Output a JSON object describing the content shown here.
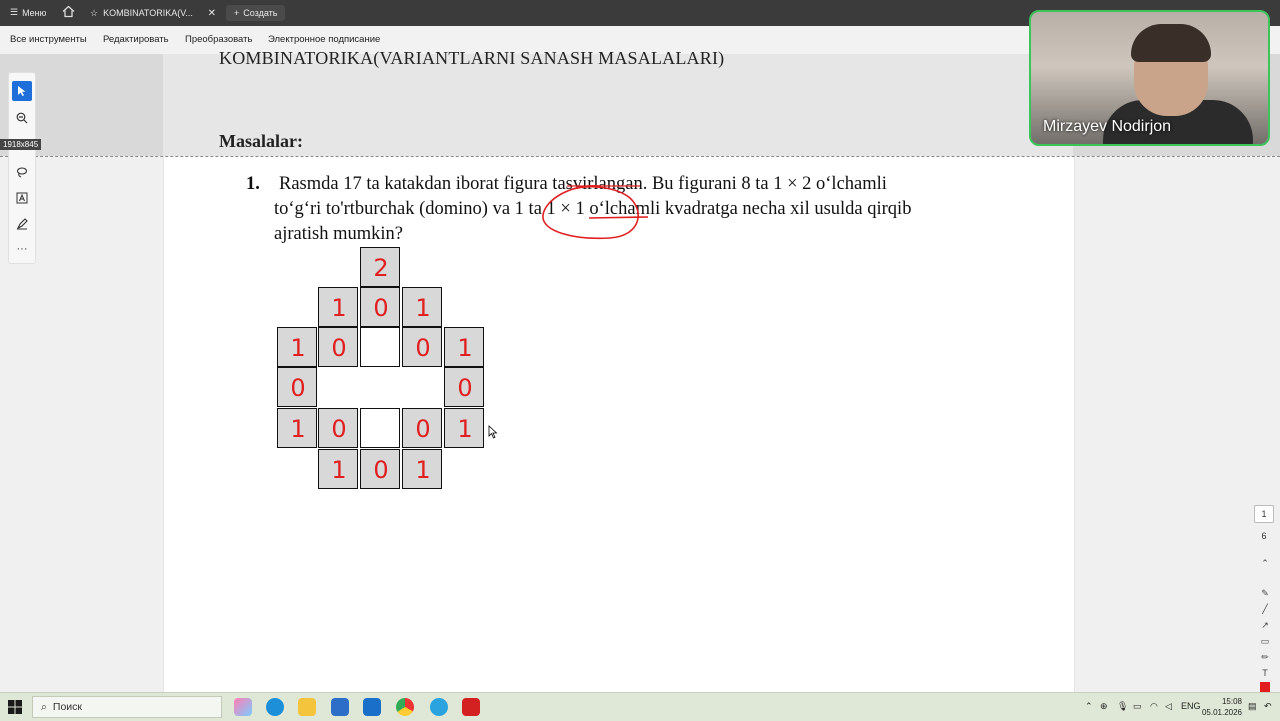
{
  "tabbar": {
    "menu_label": "Меню",
    "tab_title": "KOMBINATORIKA(V...",
    "new_tab_label": "Создать"
  },
  "menubar": {
    "items": [
      "Все инструменты",
      "Редактировать",
      "Преобразовать",
      "Электронное подписание"
    ]
  },
  "document": {
    "heading": "KOMBINATORIKA(VARIANTLARNI SANASH MASALALARI)",
    "section": "Masalalar:",
    "problem": {
      "number": "1.",
      "line1": "Rasmda 17 ta katakdan iborat figura tasvirlangan. Bu figurani 8 ta 1 × 2 o‘lchamli",
      "line2": "to‘g‘ri to'rtburchak (domino) va 1 ta 1 × 1 o‘lchamli kvadratga necha xil usulda qirqib",
      "line3": "ajratish mumkin?"
    },
    "grid_marks": [
      "2",
      "1",
      "0",
      "1",
      "1",
      "0",
      "0",
      "1",
      "0",
      "0",
      "1",
      "0",
      "0",
      "1",
      "1",
      "0",
      "1"
    ]
  },
  "size_badge": "1918x845",
  "webcam": {
    "participant": "Mirzayev Nodirjon"
  },
  "pager": {
    "current": "1",
    "total": "6"
  },
  "taskbar": {
    "search_placeholder": "Поиск",
    "lang": "ENG",
    "time": "15:08",
    "date": "05.01.2026"
  },
  "colors": {
    "accent": "#1e6fd9",
    "annotation": "#e02020",
    "webcam_border": "#3bc45a"
  }
}
